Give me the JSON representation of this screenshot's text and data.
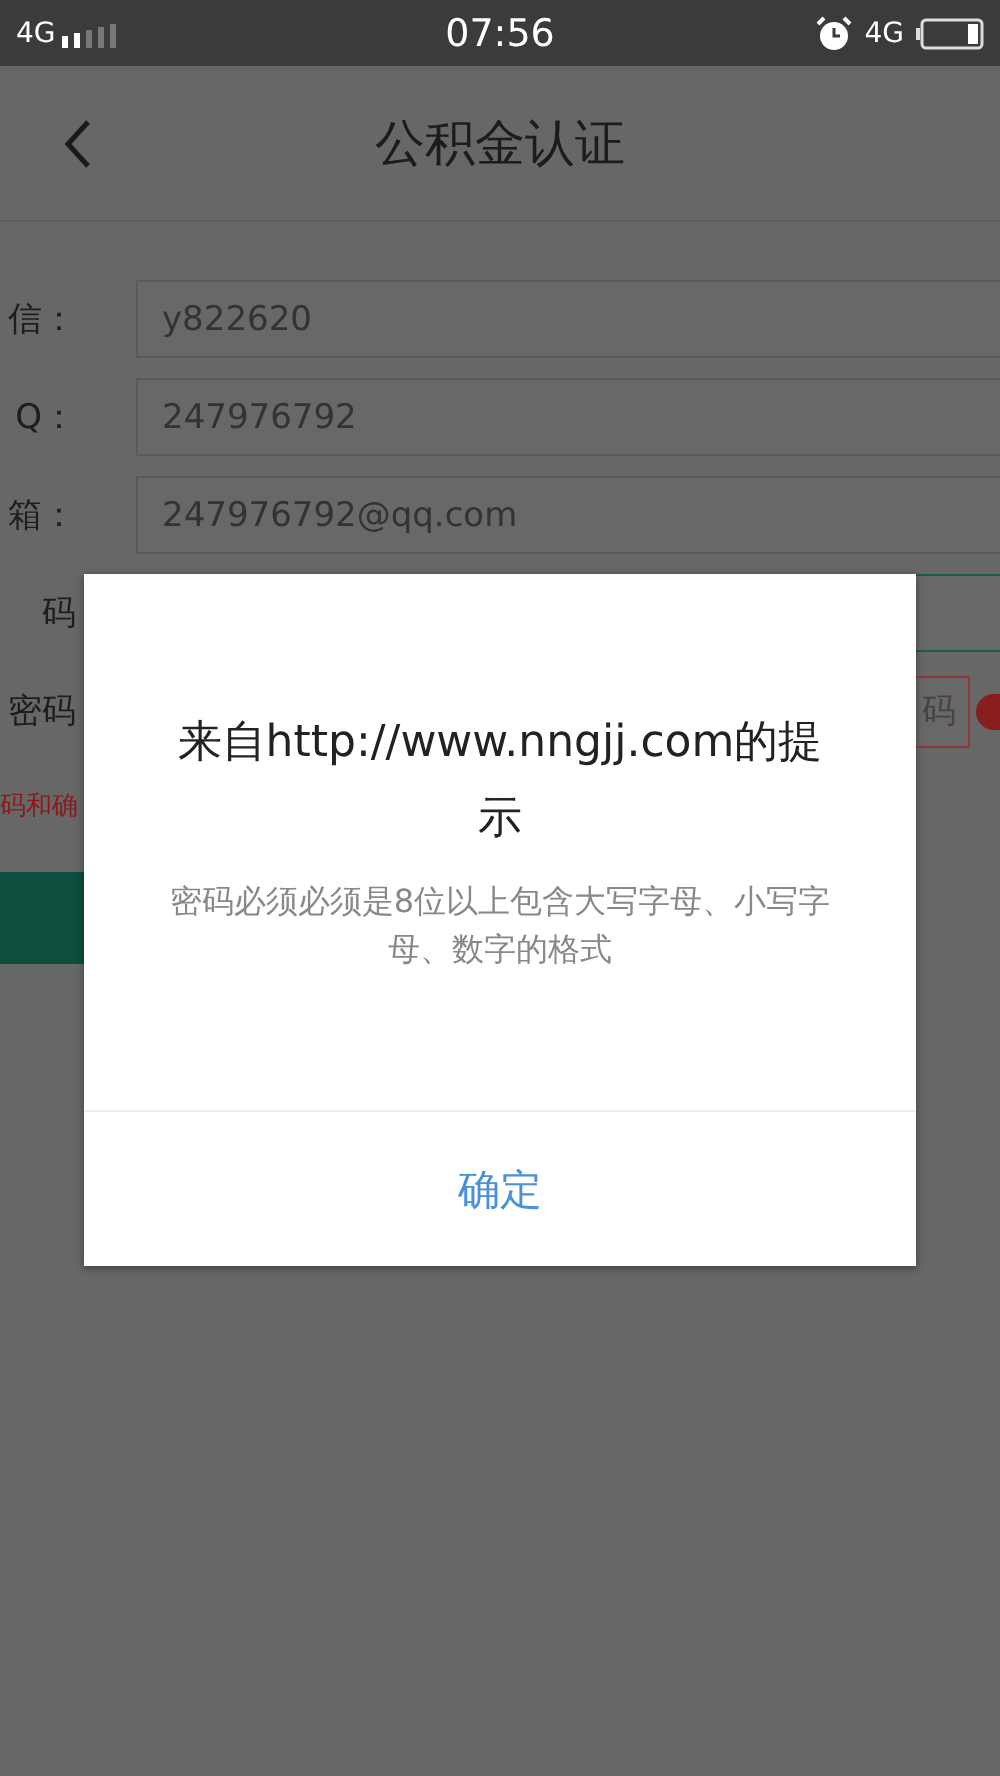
{
  "status_bar": {
    "network_left": "4G",
    "time": "07:56",
    "network_right": "4G"
  },
  "header": {
    "title": "公积金认证"
  },
  "form": {
    "rows": [
      {
        "kind": "input",
        "label": "信：",
        "value": "y822620"
      },
      {
        "kind": "input",
        "label": "Q：",
        "value": "247976792"
      },
      {
        "kind": "input",
        "label": "箱：",
        "value": "247976792@qq.com"
      },
      {
        "kind": "password",
        "label": "码"
      },
      {
        "kind": "confirm",
        "label": "密码",
        "button": "码"
      }
    ],
    "error": "码和确"
  },
  "dialog": {
    "title": "来自http://www.nngjj.com的提示",
    "message": "密码必须必须是8位以上包含大写字母、小写字母、数字的格式",
    "button": "确定"
  }
}
